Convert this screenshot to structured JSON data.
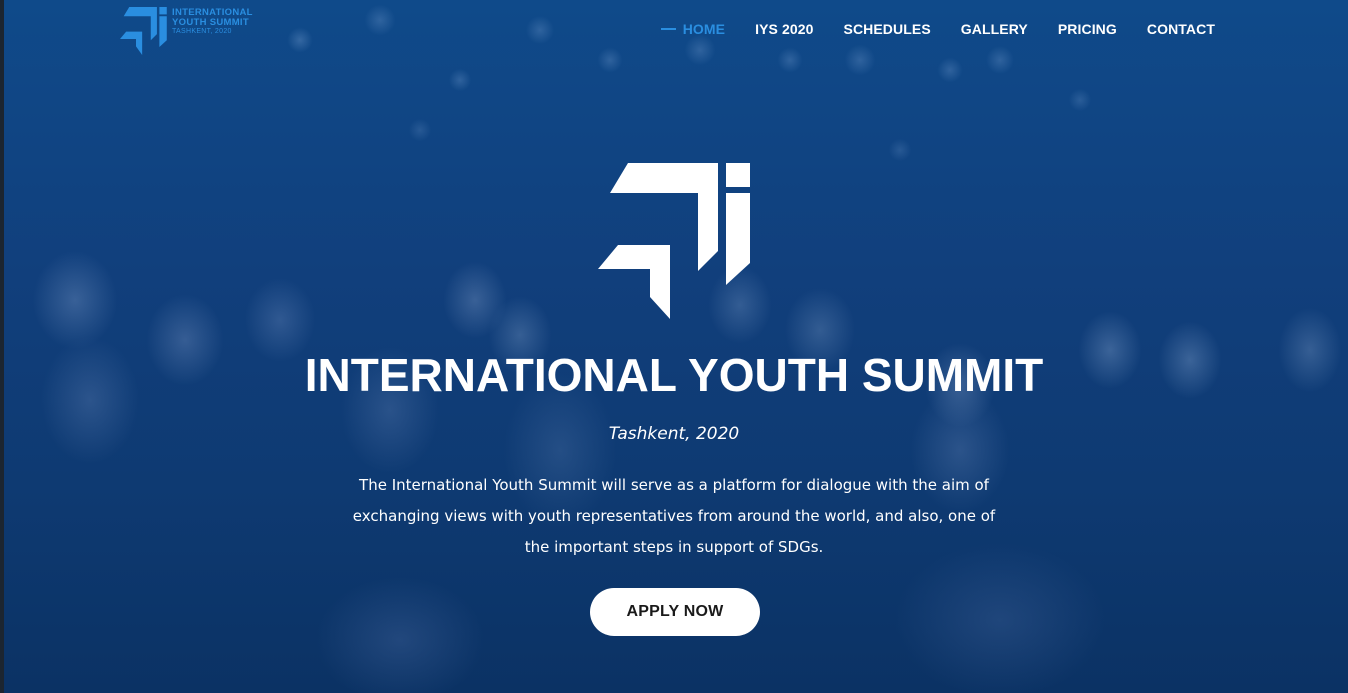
{
  "brand": {
    "name_line1": "INTERNATIONAL",
    "name_line2": "YOUTH SUMMIT",
    "location_line": "TASHKENT, 2020",
    "icon": "summit-logo-icon",
    "color": "#2a8ee0"
  },
  "nav": {
    "items": [
      {
        "label": "HOME",
        "active": true
      },
      {
        "label": "IYS 2020",
        "active": false
      },
      {
        "label": "SCHEDULES",
        "active": false
      },
      {
        "label": "GALLERY",
        "active": false
      },
      {
        "label": "PRICING",
        "active": false
      },
      {
        "label": "CONTACT",
        "active": false
      }
    ],
    "active_color": "#2a8ee0",
    "text_color": "#ffffff"
  },
  "hero": {
    "logo_icon": "summit-logo-icon",
    "title": "INTERNATIONAL YOUTH SUMMIT",
    "subtitle": "Tashkent, 2020",
    "description": "The International Youth Summit will serve as a platform for dialogue with the aim of exchanging views with youth representatives from around the world, and also, one of the important steps in support of SDGs.",
    "cta_label": "APPLY NOW",
    "overlay_color": "#0f4a8a"
  }
}
